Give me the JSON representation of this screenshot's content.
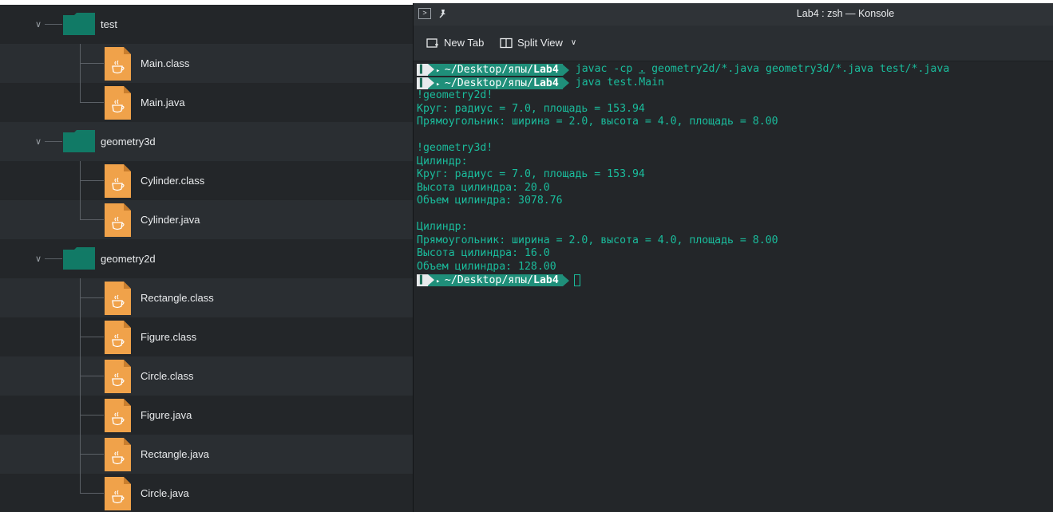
{
  "file_tree": {
    "rows": [
      {
        "type": "folder",
        "name": "test"
      },
      {
        "type": "file",
        "name": "Main.class"
      },
      {
        "type": "file",
        "name": "Main.java"
      },
      {
        "type": "folder",
        "name": "geometry3d"
      },
      {
        "type": "file",
        "name": "Cylinder.class"
      },
      {
        "type": "file",
        "name": "Cylinder.java"
      },
      {
        "type": "folder",
        "name": "geometry2d"
      },
      {
        "type": "file",
        "name": "Rectangle.class"
      },
      {
        "type": "file",
        "name": "Figure.class"
      },
      {
        "type": "file",
        "name": "Circle.class"
      },
      {
        "type": "file",
        "name": "Figure.java"
      },
      {
        "type": "file",
        "name": "Rectangle.java"
      },
      {
        "type": "file",
        "name": "Circle.java"
      }
    ]
  },
  "konsole": {
    "title": "Lab4 : zsh — Konsole",
    "toolbar": {
      "new_tab": "New Tab",
      "split_view": "Split View"
    },
    "prompt": {
      "path_prefix": "~/Desktop/япы/",
      "path_dir": "Lab4"
    },
    "commands": {
      "cmd1_a": "javac -cp ",
      "cmd1_dot": ".",
      "cmd1_b": " geometry2d/*.java geometry3d/*.java test/*.java",
      "cmd2": "java test.Main"
    },
    "output": [
      "!geometry2d!",
      "Круг: радиус = 7.0, площадь = 153.94",
      "Прямоугольник: ширина = 2.0, высота = 4.0, площадь = 8.00",
      "",
      "!geometry3d!",
      "Цилиндр:",
      "Круг: радиус = 7.0, площадь = 153.94",
      "Высота цилиндра: 20.0",
      "Объем цилиндра: 3078.76",
      "",
      "Цилиндр:",
      "Прямоугольник: ширина = 2.0, высота = 4.0, площадь = 8.00",
      "Высота цилиндра: 16.0",
      "Объем цилиндра: 128.00"
    ]
  },
  "colors": {
    "terminal_text": "#1abc9c",
    "folder": "#127a66",
    "java_file": "#f0a24a",
    "background": "#232629"
  }
}
